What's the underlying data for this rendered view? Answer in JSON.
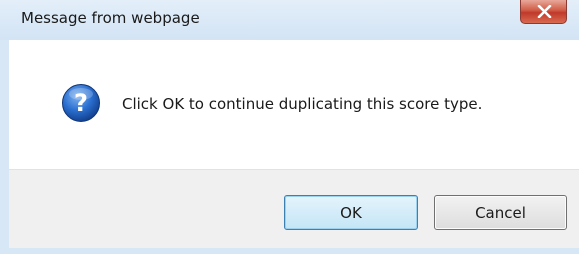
{
  "dialog": {
    "title": "Message from webpage",
    "message": "Click OK to continue duplicating this score type.",
    "icon": "question-icon",
    "ok_label": "OK",
    "cancel_label": "Cancel"
  },
  "colors": {
    "frame": "#d7e7f6",
    "close_button": "#c0392b",
    "question_icon": "#1f5fbf",
    "footer": "#f0f0f0"
  }
}
